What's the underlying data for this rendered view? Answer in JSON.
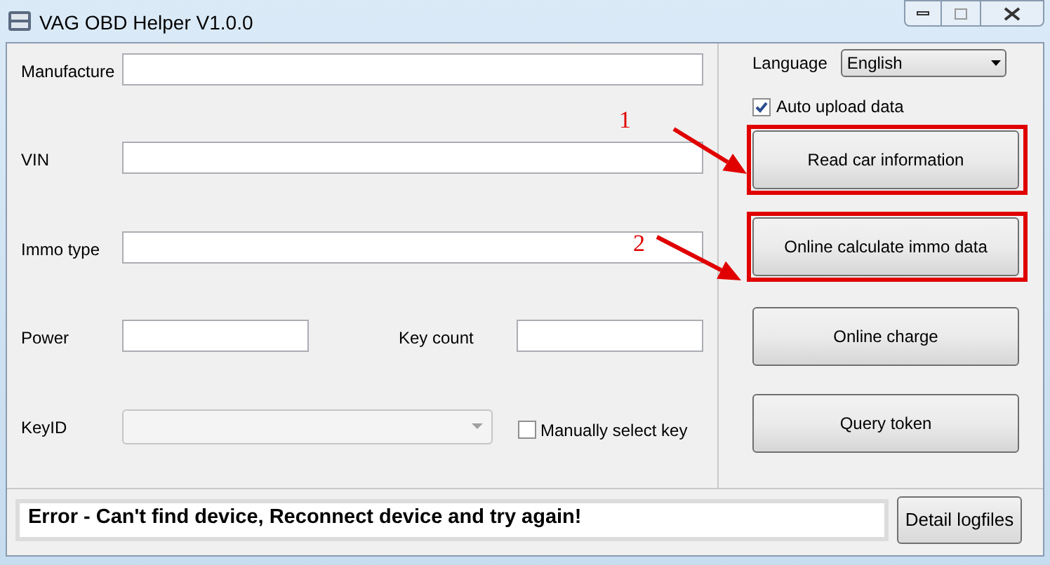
{
  "window": {
    "title": "VAG OBD Helper V1.0.0"
  },
  "fields": [
    {
      "label": "Manufacture"
    },
    {
      "label": "VIN"
    },
    {
      "label": "Immo type"
    }
  ],
  "small_fields": [
    {
      "label": "Power"
    },
    {
      "label": "Key count"
    }
  ],
  "key_id": {
    "label": "KeyID",
    "disabled": true
  },
  "manual_select": {
    "label": "Manually select key",
    "checked": false
  },
  "language": {
    "label": "Language",
    "value": "English"
  },
  "auto_upload": {
    "label": "Auto upload data",
    "checked": true
  },
  "buttons": [
    {
      "label": "Read car information",
      "highlighted": true,
      "step": "1"
    },
    {
      "label": "Online calculate immo data",
      "highlighted": true,
      "step": "2"
    },
    {
      "label": "Online charge",
      "highlighted": false
    },
    {
      "label": "Query token",
      "highlighted": false
    }
  ],
  "status": {
    "message": "Error - Can't find device, Reconnect device and try again!"
  },
  "detail_button": "Detail logfiles"
}
